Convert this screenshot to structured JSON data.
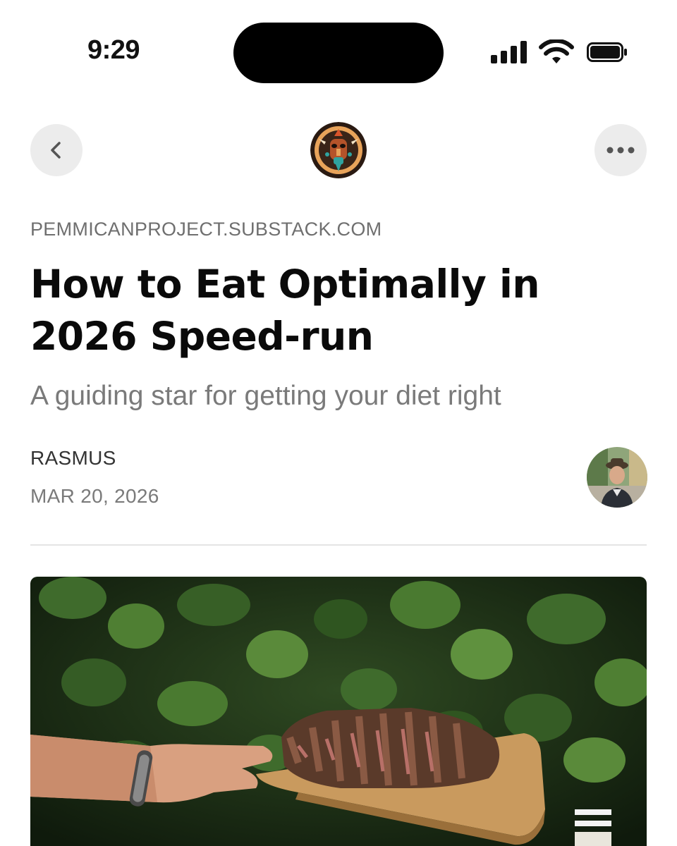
{
  "status_bar": {
    "time": "9:29"
  },
  "nav": {
    "back_icon": "chevron-left-icon",
    "more_icon": "ellipsis-icon",
    "publication_logo": "tribal-mask-logo"
  },
  "article": {
    "domain": "PEMMICANPROJECT.SUBSTACK.COM",
    "title": "How to Eat Optimally in 2026 Speed-run",
    "subtitle": "A guiding star for getting your diet right",
    "author": "RASMUS",
    "date": "MAR 20, 2026"
  },
  "hero_image": {
    "description_icon": "steak-on-board-photo"
  },
  "colors": {
    "nav_button_bg": "#ececec",
    "muted_text": "#7a7a7a",
    "divider": "#e4e4e4"
  }
}
